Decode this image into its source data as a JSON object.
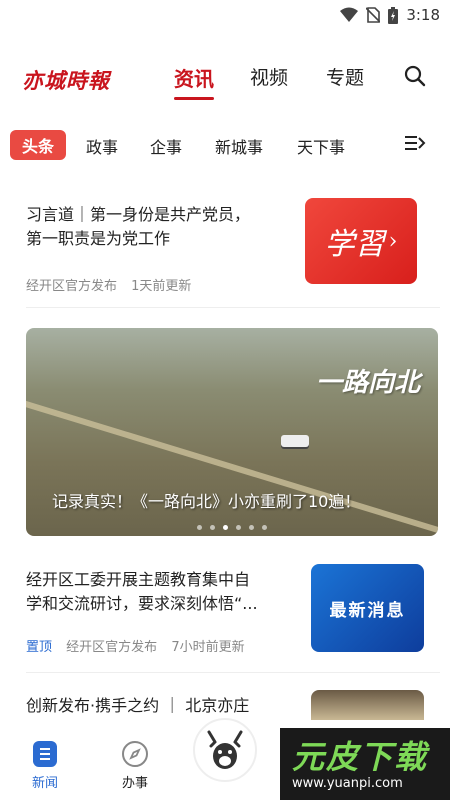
{
  "status_bar": {
    "time": "3:18",
    "icons": [
      "wifi-icon",
      "no-sim-icon",
      "battery-charging-icon"
    ]
  },
  "header": {
    "logo": "亦城時報",
    "tabs": [
      {
        "label": "资讯",
        "active": true
      },
      {
        "label": "视频"
      },
      {
        "label": "专题"
      }
    ],
    "search_icon": "search-icon"
  },
  "categories": {
    "items": [
      {
        "label": "头条",
        "active": true
      },
      {
        "label": "政事"
      },
      {
        "label": "企事"
      },
      {
        "label": "新城事"
      },
      {
        "label": "天下事"
      }
    ],
    "more_icon": "menu-expand-icon"
  },
  "feed": {
    "article1": {
      "title_line1": "习言道｜第一身份是共产党员，",
      "title_line2": "第一职责是为党工作",
      "source": "经开区官方发布",
      "time": "1天前更新",
      "thumb_text": "学習"
    },
    "banner": {
      "overlay": "一路向北",
      "caption": "记录真实！《一路向北》小亦重刷了10遍！",
      "dots": 6,
      "active_dot": 2
    },
    "article2": {
      "title_line1": "经开区工委开展主题教育集中自",
      "title_line2": "学和交流研讨，要求深刻体悟“...",
      "pin": "置顶",
      "source": "经开区官方发布",
      "time": "7小时前更新",
      "thumb_text": "最新消息"
    },
    "article3": {
      "title_partial": "创新发布·携手之约 ｜ 北京亦庄"
    }
  },
  "bottom_nav": {
    "items": [
      {
        "label": "新闻",
        "icon": "news-icon",
        "active": true
      },
      {
        "label": "办事",
        "icon": "compass-icon"
      }
    ],
    "center_icon": "deer-mascot-icon"
  },
  "watermark": {
    "main": "元皮下载",
    "url": "www.yuanpi.com"
  },
  "colors": {
    "accent_red": "#c9151e",
    "category_red": "#e94a42",
    "link_blue": "#2b6bd1"
  }
}
